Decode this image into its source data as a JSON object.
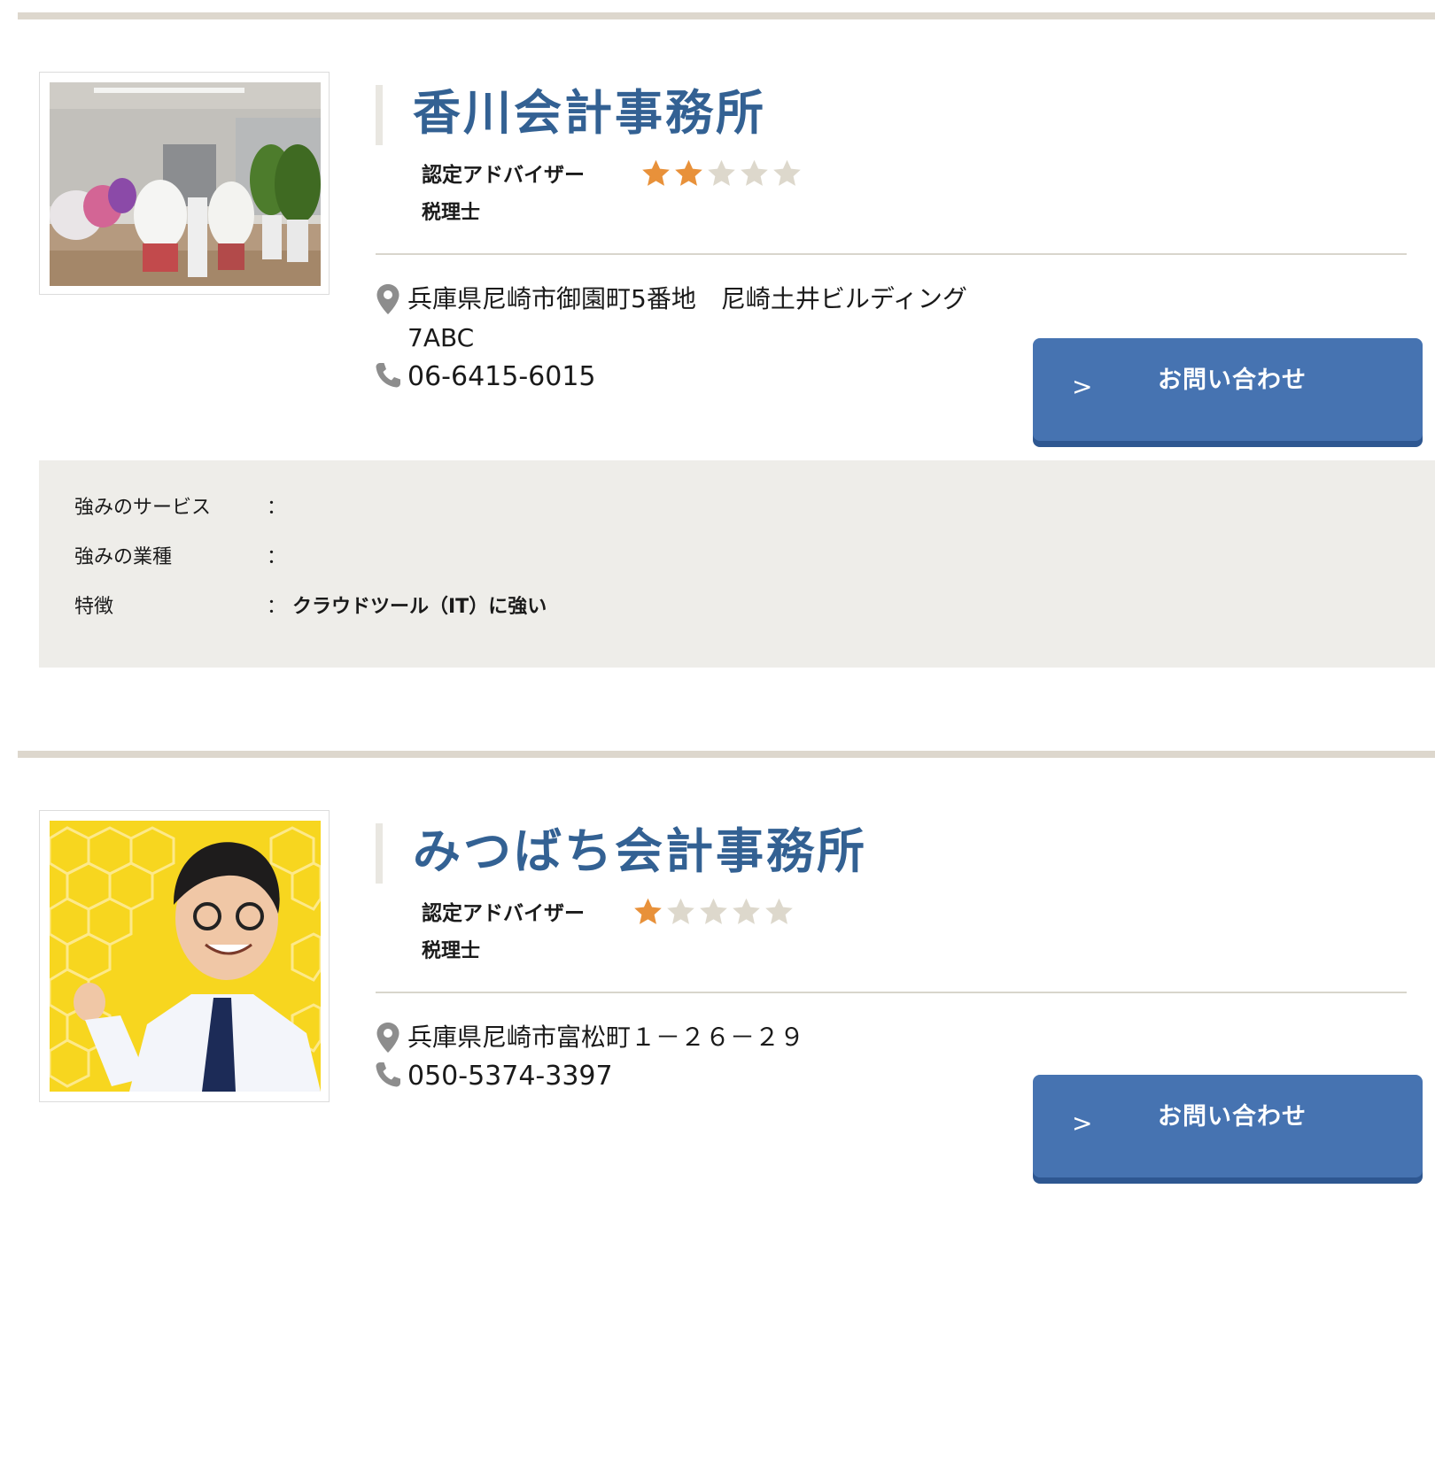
{
  "offices": [
    {
      "name": "香川会計事務所",
      "advisor_label": "認定アドバイザー",
      "rating": 2,
      "rating_max": 5,
      "qualification": "税理士",
      "address_line1": "兵庫県尼崎市御園町5番地　尼崎土井ビルディング",
      "address_line2": "7ABC",
      "phone": "06-6415-6015",
      "contact_chevron": ">",
      "contact_label": "お問い合わせ",
      "details": [
        {
          "key": "強みのサービス",
          "colon": "：",
          "value": ""
        },
        {
          "key": "強みの業種",
          "colon": "：",
          "value": ""
        },
        {
          "key": "特徴",
          "colon": "：",
          "value": "クラウドツール（IT）に強い"
        }
      ]
    },
    {
      "name": "みつばち会計事務所",
      "advisor_label": "認定アドバイザー",
      "rating": 1,
      "rating_max": 5,
      "qualification": "税理士",
      "address_line1": "兵庫県尼崎市富松町１－２６－２９",
      "phone": "050-5374-3397",
      "contact_chevron": ">",
      "contact_label": "お問い合わせ"
    }
  ],
  "colors": {
    "title": "#336193",
    "star_on": "#e8913a",
    "star_off": "#ddd8cc",
    "button": "#4673b1",
    "rule": "#ddd7cd",
    "info_bg": "#eeede9"
  },
  "icons": [
    "map-pin-icon",
    "phone-icon",
    "star-icon",
    "chevron-right-icon"
  ]
}
